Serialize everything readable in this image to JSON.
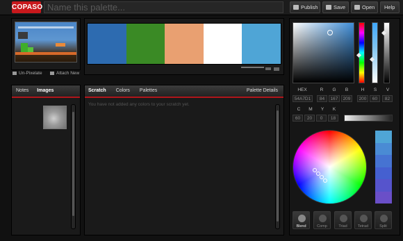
{
  "app": {
    "logo": "COPASO"
  },
  "header": {
    "name_placeholder": "Name this palette...",
    "publish_label": "Publish",
    "save_label": "Save",
    "open_label": "Open",
    "help_label": "Help"
  },
  "image_panel": {
    "unpixelate_label": "Un-Pixelate",
    "attach_label": "Attach New"
  },
  "palette": {
    "colors": [
      "#2D6BB0",
      "#3A8A25",
      "#E9A071",
      "#FFFFFF",
      "#4FA5D6"
    ]
  },
  "left_tabs": {
    "notes": "Notes",
    "images": "Images"
  },
  "mid_tabs": {
    "scratch": "Scratch",
    "colors": "Colors",
    "palettes": "Palettes",
    "details": "Palette Details"
  },
  "scratch": {
    "message": "You have not added any colors to your scratch yet."
  },
  "picker": {
    "labels": {
      "hex": "HEX",
      "r": "R",
      "g": "G",
      "b": "B",
      "h": "H",
      "s": "S",
      "v": "V",
      "c": "C",
      "m": "M",
      "y": "Y",
      "k": "K"
    },
    "values": {
      "hex": "54A7D1",
      "r": "84",
      "g": "167",
      "b": "209",
      "h": "200",
      "s": "60",
      "v": "82",
      "c": "60",
      "m": "20",
      "y": "0",
      "k": "18"
    }
  },
  "harmony": {
    "strip_colors": [
      "#4FA5D6",
      "#4A8BD4",
      "#4673D2",
      "#4560D0",
      "#5654CC",
      "#6A4FC8"
    ],
    "buttons": {
      "blend": "Blend",
      "comp": "Comp",
      "triad": "Triad",
      "tetrad": "Tetrad",
      "split": "Split"
    }
  },
  "accent": "#C8181C"
}
